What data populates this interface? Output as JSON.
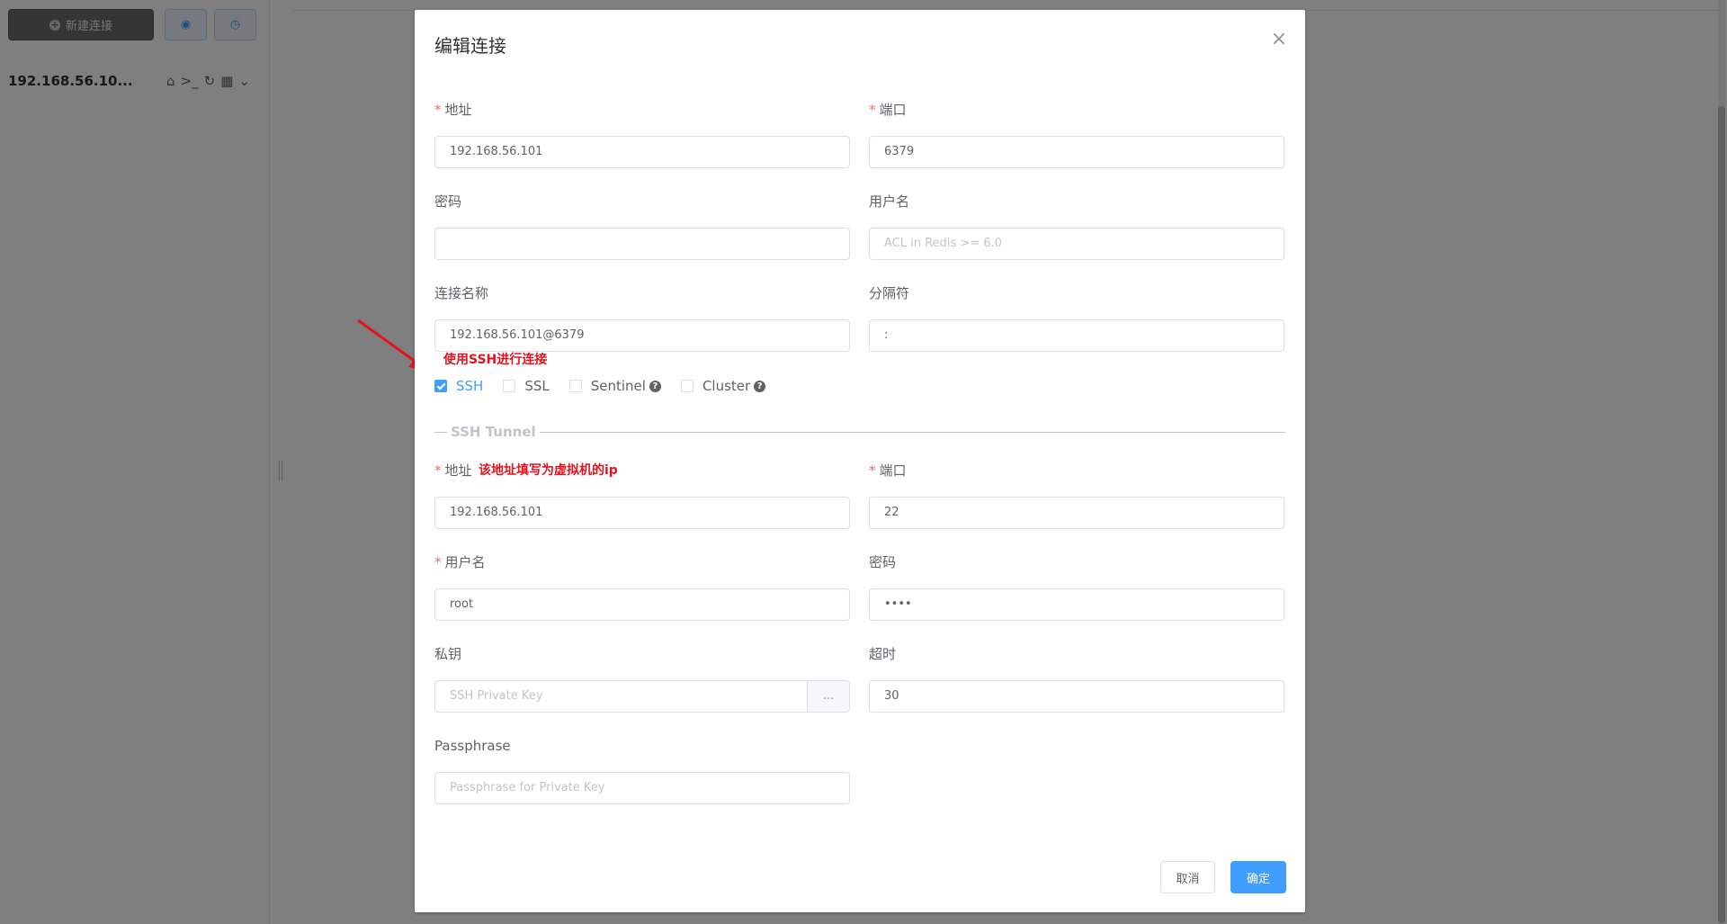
{
  "app": {
    "new_connection_label": "新建连接",
    "connection_name": "192.168.56.10..."
  },
  "dialog": {
    "title": "编辑连接",
    "close": "×",
    "host": {
      "label": "地址",
      "value": "192.168.56.101"
    },
    "port": {
      "label": "端口",
      "value": "6379"
    },
    "password": {
      "label": "密码",
      "value": ""
    },
    "username": {
      "label": "用户名",
      "placeholder": "ACL in Redis >= 6.0"
    },
    "conn_name": {
      "label": "连接名称",
      "value": "192.168.56.101@6379"
    },
    "separator": {
      "label": "分隔符",
      "value": ":"
    },
    "options": {
      "ssh": {
        "label": "SSH",
        "checked": true
      },
      "ssl": {
        "label": "SSL",
        "checked": false
      },
      "sentinel": {
        "label": "Sentinel",
        "checked": false
      },
      "cluster": {
        "label": "Cluster",
        "checked": false
      }
    },
    "ssh_tunnel": {
      "title": "SSH Tunnel",
      "host": {
        "label": "地址",
        "value": "192.168.56.101"
      },
      "port": {
        "label": "端口",
        "value": "22"
      },
      "username": {
        "label": "用户名",
        "value": "root"
      },
      "password": {
        "label": "密码",
        "value": "••••"
      },
      "private_key": {
        "label": "私钥",
        "placeholder": "SSH Private Key",
        "button": "..."
      },
      "timeout": {
        "label": "超时",
        "value": "30"
      },
      "passphrase": {
        "label": "Passphrase",
        "placeholder": "Passphrase for Private Key"
      }
    },
    "cancel_label": "取消",
    "confirm_label": "确定"
  },
  "annotations": {
    "ssh_note": "使用SSH进行连接",
    "ip_note": "该地址填写为虚拟机的ip"
  },
  "colors": {
    "primary": "#409eff",
    "annotation": "#e6121e",
    "required": "#f56c6c"
  }
}
